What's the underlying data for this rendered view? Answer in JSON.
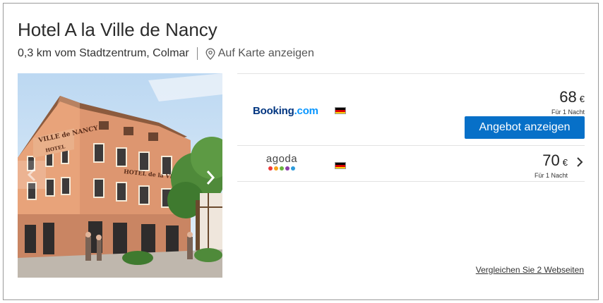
{
  "hotel": {
    "name": "Hotel A la Ville de Nancy",
    "distance": "0,3 km vom Stadtzentrum, Colmar",
    "map_link": "Auf Karte anzeigen",
    "sign_text": "VILLE de NANCY",
    "sign_hotel": "HOTEL",
    "sign_side": "HOTEL de la VILLE"
  },
  "offers": [
    {
      "provider": "Booking.com",
      "provider_name": "Booking",
      "provider_suffix": ".com",
      "price": "68",
      "currency": "€",
      "per_night": "Für 1 Nacht",
      "cta": "Angebot anzeigen"
    },
    {
      "provider": "agoda",
      "price": "70",
      "currency": "€",
      "per_night": "Für 1 Nacht"
    }
  ],
  "compare_link": "Vergleichen Sie 2 Webseiten",
  "colors": {
    "cta_blue": "#0770c8",
    "booking_navy": "#003580",
    "booking_light": "#0896ff",
    "agoda_dots": [
      "#ee3a3a",
      "#f6a21b",
      "#6ab43e",
      "#8c3ea8",
      "#2e9bdb"
    ]
  },
  "icons": [
    "map-pin-icon",
    "chevron-left-icon",
    "chevron-right-icon",
    "german-flag-icon"
  ]
}
